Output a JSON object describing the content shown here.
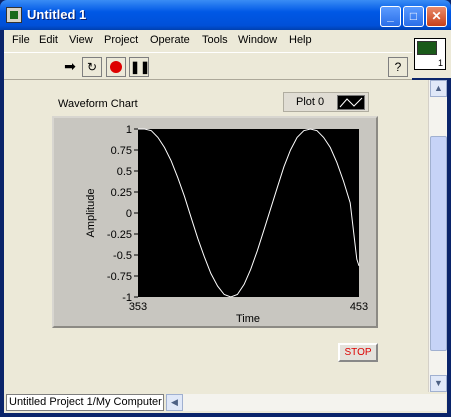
{
  "window": {
    "title": "Untitled 1"
  },
  "title_buttons": {
    "minimize": "_",
    "maximize": "□",
    "close": "✕"
  },
  "menu": {
    "items": [
      "File",
      "Edit",
      "View",
      "Project",
      "Operate",
      "Tools",
      "Window",
      "Help"
    ]
  },
  "toolbar": {
    "run_icon": "run-arrow-icon",
    "run_continuously_icon": "run-continuously-icon",
    "abort_icon": "abort-stop-icon",
    "pause_icon": "pause-icon",
    "help_label": "?"
  },
  "vi_icon": {
    "number": "1"
  },
  "front_panel": {
    "chart_label": "Waveform Chart",
    "legend_label": "Plot 0",
    "stop_label": "STOP"
  },
  "statusbar": {
    "project_path": "Untitled Project 1/My Computer"
  },
  "chart_data": {
    "type": "line",
    "xlabel": "Time",
    "ylabel": "Amplitude",
    "xlim": [
      353,
      453
    ],
    "ylim": [
      -1,
      1
    ],
    "x_ticks": [
      "353",
      "453"
    ],
    "y_ticks": [
      "1",
      "0.75",
      "0.5",
      "0.25",
      "0",
      "-0.25",
      "-0.5",
      "-0.75",
      "-1"
    ],
    "series": [
      {
        "name": "Plot 0",
        "color": "#ffffff",
        "x": [
          353,
          356,
          359,
          362,
          365,
          368,
          371,
          374,
          377,
          380,
          383,
          386,
          389,
          392,
          395,
          398,
          401,
          404,
          407,
          410,
          413,
          416,
          419,
          422,
          425,
          428,
          431,
          434,
          437,
          440,
          443,
          446,
          449,
          452,
          453
        ],
        "y": [
          1,
          1,
          0.98,
          0.9,
          0.78,
          0.62,
          0.42,
          0.2,
          -0.05,
          -0.3,
          -0.52,
          -0.72,
          -0.87,
          -0.97,
          -1,
          -0.97,
          -0.85,
          -0.67,
          -0.45,
          -0.2,
          0.05,
          0.3,
          0.55,
          0.75,
          0.9,
          0.98,
          1,
          0.98,
          0.9,
          0.78,
          0.6,
          0.38,
          0.12,
          -0.55,
          -0.63
        ]
      }
    ]
  }
}
